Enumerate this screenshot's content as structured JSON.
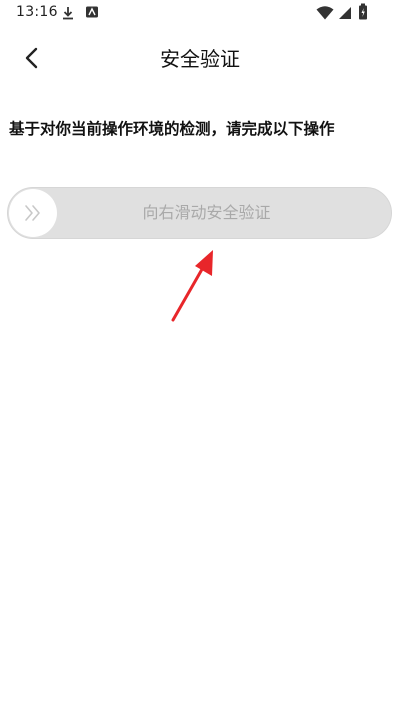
{
  "status_bar": {
    "time": "13:16",
    "icons": [
      "download-icon",
      "app-notification-icon",
      "wifi-icon",
      "signal-icon",
      "battery-icon"
    ]
  },
  "header": {
    "title": "安全验证",
    "back_icon": "chevron-left-icon"
  },
  "instruction": "基于对你当前操作环境的检测，请完成以下操作",
  "slider": {
    "label": "向右滑动安全验证",
    "handle_icon": "double-chevron-right-icon",
    "progress": 0
  },
  "annotation": {
    "arrow_color": "#e8262a"
  },
  "colors": {
    "track": "#e0e0e0",
    "track_text": "#a9a9a9",
    "handle": "#ffffff",
    "handle_icon": "#c8c8c8"
  }
}
